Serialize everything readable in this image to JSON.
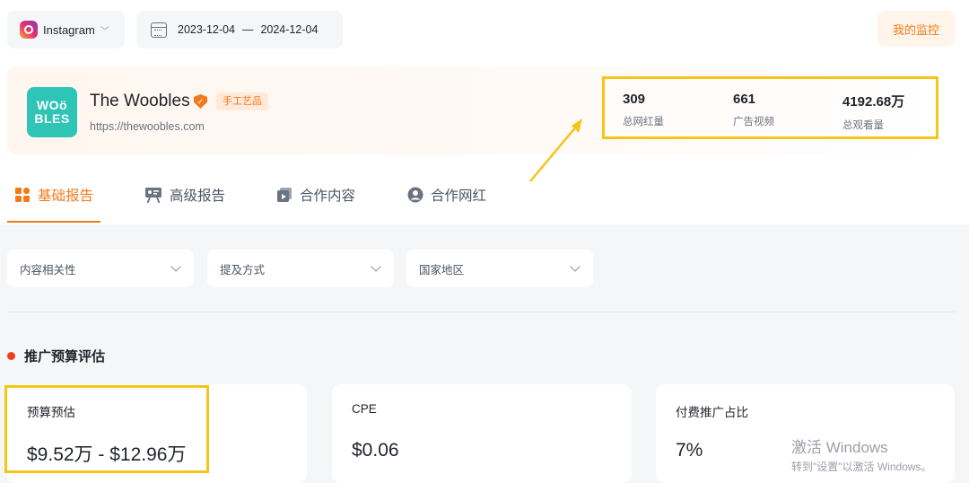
{
  "header": {
    "platform": "Instagram",
    "date_start": "2023-12-04",
    "date_sep": "—",
    "date_end": "2024-12-04",
    "monitor_label": "我的监控"
  },
  "brand": {
    "logo_line1": "WOö",
    "logo_line2": "BLES",
    "name": "The Woobles",
    "tag": "手工艺品",
    "url": "https://thewoobles.com",
    "stats": [
      {
        "value": "309",
        "label": "总网红量"
      },
      {
        "value": "661",
        "label": "广告视频"
      },
      {
        "value": "4192.68万",
        "label": "总观看量"
      }
    ]
  },
  "tabs": [
    {
      "label": "基础报告",
      "icon": "grid-icon"
    },
    {
      "label": "高级报告",
      "icon": "presentation-icon"
    },
    {
      "label": "合作内容",
      "icon": "video-icon"
    },
    {
      "label": "合作网红",
      "icon": "user-icon"
    }
  ],
  "filters": [
    {
      "placeholder": "内容相关性"
    },
    {
      "placeholder": "提及方式"
    },
    {
      "placeholder": "国家地区"
    }
  ],
  "section": {
    "title": "推广预算评估"
  },
  "metrics": [
    {
      "label": "预算预估",
      "value": "$9.52万 - $12.96万"
    },
    {
      "label": "CPE",
      "value": "$0.06"
    },
    {
      "label": "付费推广占比",
      "value": "7%"
    }
  ],
  "watermark": {
    "line1": "激活 Windows",
    "line2": "转到\"设置\"以激活 Windows。"
  },
  "colors": {
    "accent": "#f27a1a",
    "highlight": "#f5c518"
  }
}
